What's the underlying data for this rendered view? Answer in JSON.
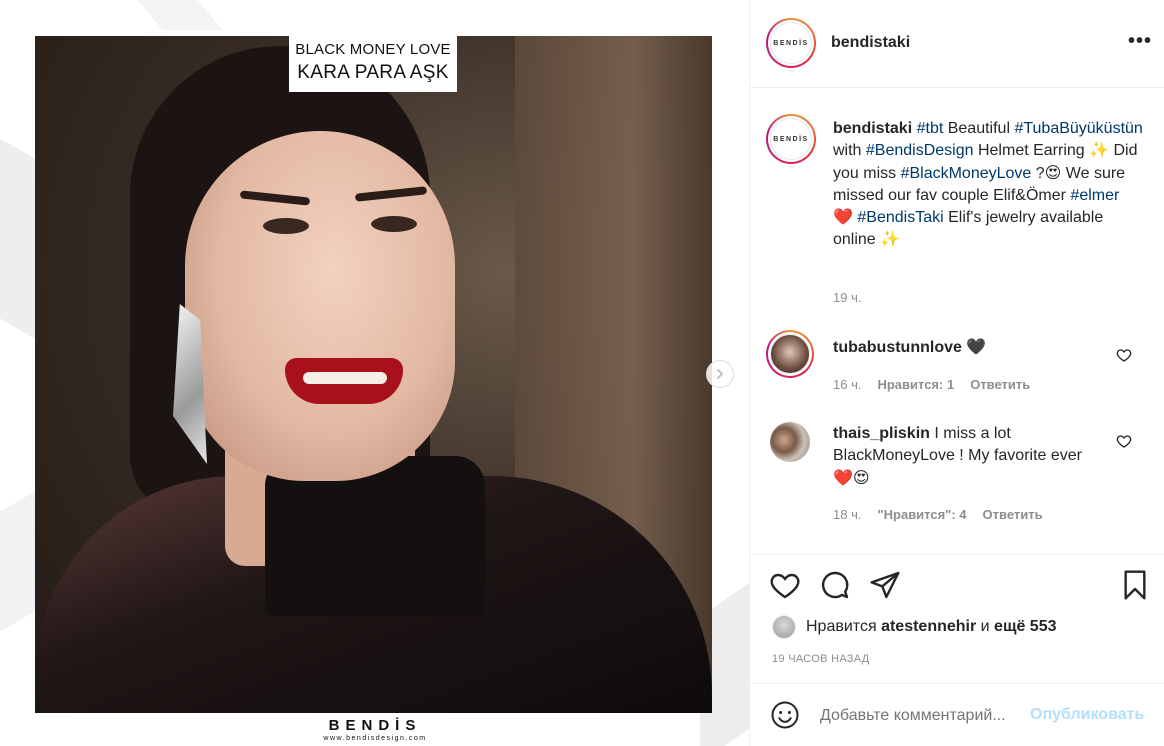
{
  "post": {
    "image_caption_line1": "BLACK MONEY LOVE",
    "image_caption_line2": "KARA PARA AŞK",
    "brand_logo_text": "BENDİS",
    "brand_site": "www.bendisdesign.com"
  },
  "header": {
    "avatar_text": "BENDİS",
    "username": "bendistaki",
    "more_label": "•••"
  },
  "caption": {
    "username": "bendistaki",
    "parts": {
      "t1": "#tbt",
      "t2": " Beautiful ",
      "t3": "#TubaBüyüküstün",
      "t4": " with ",
      "t5": "#BendisDesign",
      "t6": " Helmet Earring ✨ Did you miss ",
      "t7": "#BlackMoneyLove",
      "t8": " ?😍 We sure missed our fav couple Elif&Ömer ",
      "t9": "#elmer",
      "t10": " ❤️ ",
      "t11": "#BendisTaki",
      "t12": " Elif's jewelry available online ✨"
    },
    "time": "19 ч."
  },
  "comments": [
    {
      "username": "tubabustunnlove",
      "text": " 🖤",
      "time": "16 ч.",
      "likes": "Нравится: 1",
      "reply": "Ответить"
    },
    {
      "username": "thais_pliskin",
      "text": " I miss a lot BlackMoneyLove ! My favorite ever ❤️😍",
      "time": "18 ч.",
      "likes": "\"Нравится\": 4",
      "reply": "Ответить"
    }
  ],
  "likes": {
    "prefix": "Нравится ",
    "user": "atestennehir",
    "middle": " и ",
    "rest": "ещё 553"
  },
  "timestamp": "19 ЧАСОВ НАЗАД",
  "add_comment": {
    "placeholder": "Добавьте комментарий...",
    "post_label": "Опубликовать"
  },
  "colors": {
    "hashtag": "#00376b",
    "muted": "#8e8e8e",
    "post_button": "#b2dffc"
  }
}
